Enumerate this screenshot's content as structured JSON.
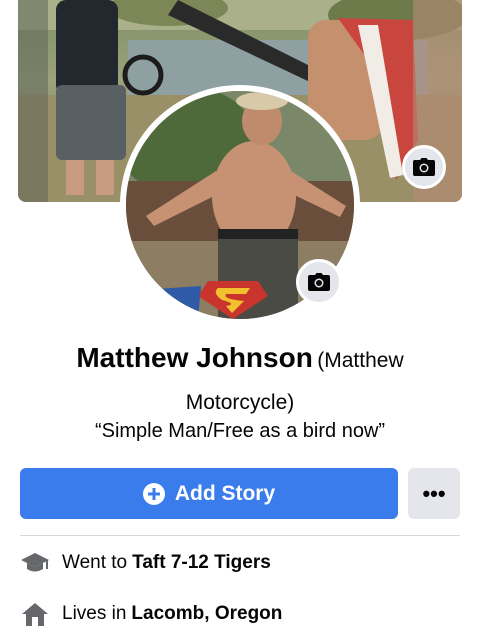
{
  "profile": {
    "name": "Matthew Johnson",
    "alternate_name": "(Matthew Motorcycle)",
    "bio": "“Simple Man/Free as a bird now”"
  },
  "actions": {
    "add_story_label": "Add Story",
    "more_label": "•••"
  },
  "intro": {
    "education": {
      "prefix": "Went to",
      "value": "Taft 7-12 Tigers",
      "icon": "graduation-cap-icon"
    },
    "residence": {
      "prefix": "Lives in",
      "value": "Lacomb, Oregon",
      "icon": "home-icon"
    }
  },
  "colors": {
    "primary_button": "#3b7ced",
    "secondary_button": "#e4e6eb",
    "icon_gray": "#65676b"
  }
}
